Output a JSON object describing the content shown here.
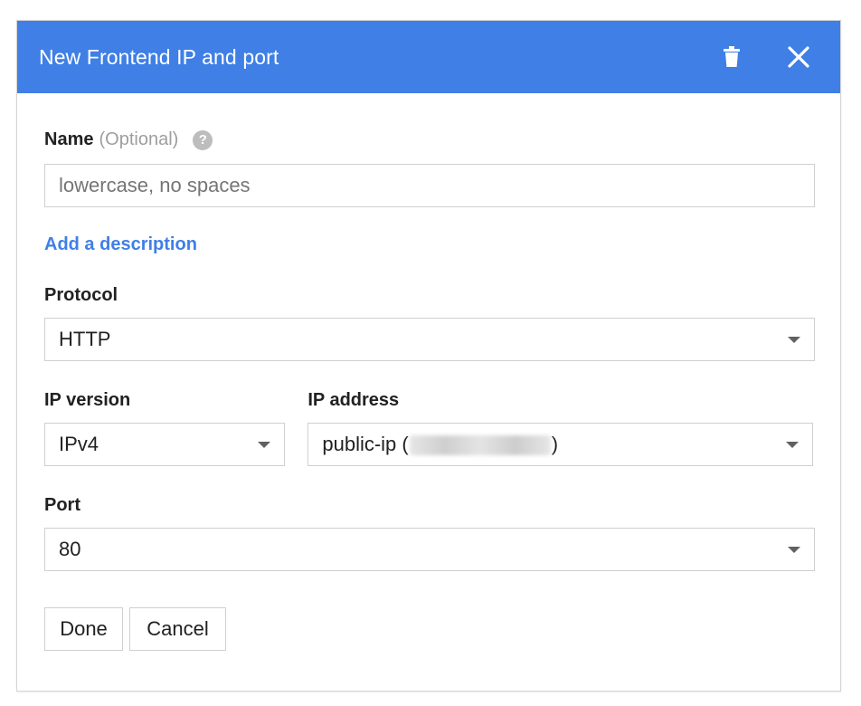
{
  "header": {
    "title": "New Frontend IP and port",
    "delete_icon": "trash-icon",
    "close_icon": "close-icon",
    "color": "#3f7fe6"
  },
  "name_field": {
    "label": "Name",
    "optional": "(Optional)",
    "help_icon": "help-icon",
    "help_glyph": "?",
    "value": "",
    "placeholder": "lowercase, no spaces"
  },
  "description_link": "Add a description",
  "protocol": {
    "label": "Protocol",
    "value": "HTTP"
  },
  "ip_version": {
    "label": "IP version",
    "value": "IPv4"
  },
  "ip_address": {
    "label": "IP address",
    "value_prefix": "public-ip (",
    "value_suffix": ")"
  },
  "port": {
    "label": "Port",
    "value": "80"
  },
  "actions": {
    "done": "Done",
    "cancel": "Cancel"
  }
}
